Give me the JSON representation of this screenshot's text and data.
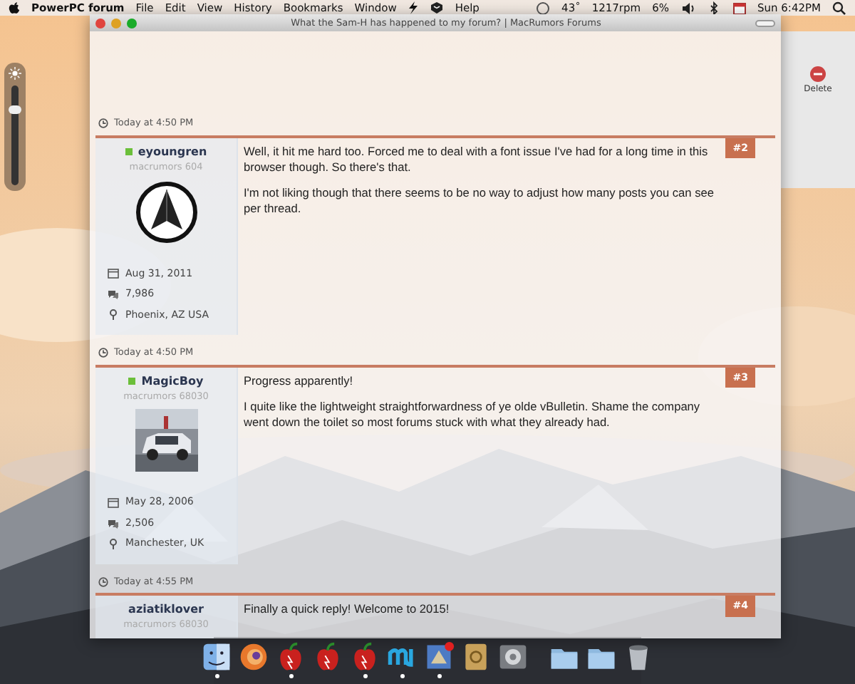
{
  "menu_bar": {
    "app_name": "PowerPC forum",
    "menus": [
      "File",
      "Edit",
      "View",
      "History",
      "Bookmarks",
      "Window",
      "Help"
    ],
    "status": [
      "43˚",
      "1217rpm",
      "6%",
      "Sun 6:42PM"
    ]
  },
  "brightness": {
    "level": 0.78
  },
  "window": {
    "title": "What the Sam-H has happened to my forum? | MacRumors Forums"
  },
  "background_window": {
    "button": "Delete"
  },
  "posts": [
    {
      "time": "Today at 4:50 PM",
      "number": "#2",
      "user": {
        "name": "eyoungren",
        "online": true,
        "rank": "macrumors 604",
        "joined": "Aug 31, 2011",
        "messages": "7,986",
        "location": "Phoenix, AZ USA"
      },
      "paragraphs": [
        "Well, it hit me hard too. Forced me to deal with a font issue I've had for a long time in this browser though. So there's that.",
        "I'm not liking though that there seems to be no way to adjust how many posts you can see per thread."
      ]
    },
    {
      "time": "Today at 4:50 PM",
      "number": "#3",
      "user": {
        "name": "MagicBoy",
        "online": true,
        "rank": "macrumors 68030",
        "joined": "May 28, 2006",
        "messages": "2,506",
        "location": "Manchester, UK"
      },
      "paragraphs": [
        "Progress apparently!",
        "I quite like the lightweight straightforwardness of ye olde vBulletin. Shame the company went down the toilet so most forums stuck with what they already had."
      ]
    },
    {
      "time": "Today at 4:55 PM",
      "number": "#4",
      "user": {
        "name": "aziatiklover",
        "online": false,
        "rank": "macrumors 68030"
      },
      "paragraphs": [
        "Finally a quick reply! Welcome to 2015!"
      ]
    }
  ],
  "dock": [
    {
      "running": true
    },
    {
      "running": false
    },
    {
      "running": true
    },
    {
      "running": false
    },
    {
      "running": true
    },
    {
      "running": true
    },
    {
      "running": true
    },
    {
      "running": false
    },
    {
      "running": false
    },
    {
      "running": false
    },
    {
      "running": false
    },
    {
      "running": false
    }
  ]
}
